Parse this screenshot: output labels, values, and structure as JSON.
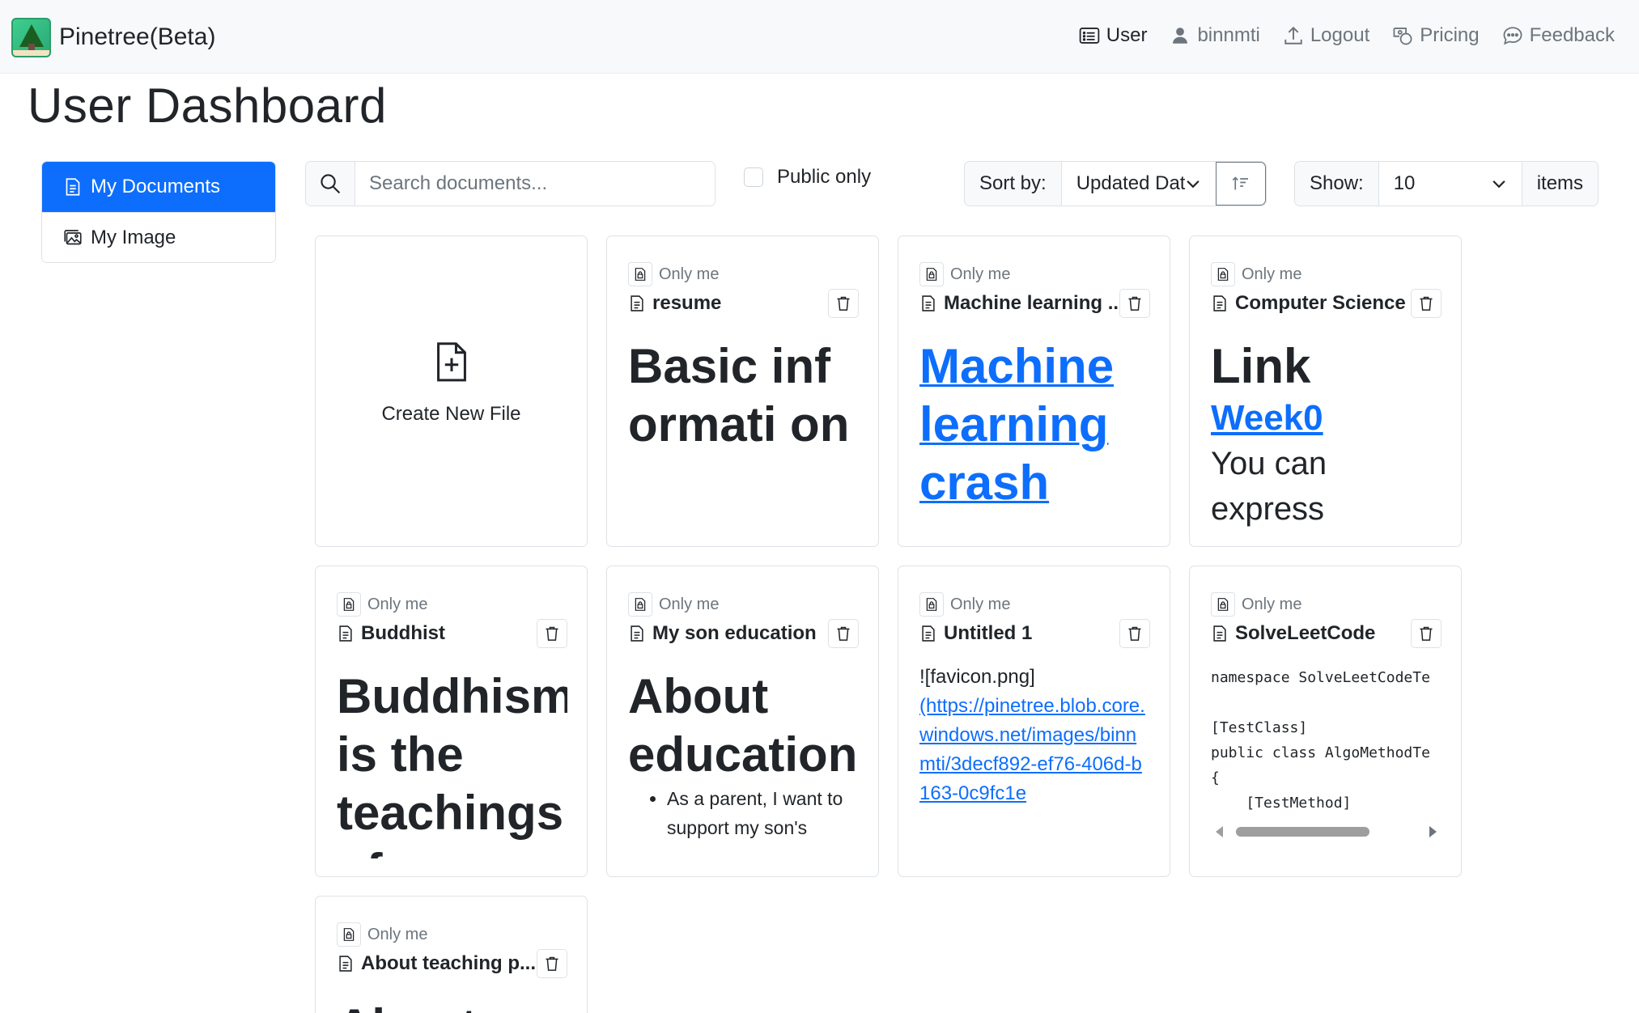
{
  "navbar": {
    "brand": "Pinetree(Beta)",
    "links": [
      {
        "label": "User",
        "icon": "card-list-icon",
        "active": true
      },
      {
        "label": "binnmti",
        "icon": "person-icon"
      },
      {
        "label": "Logout",
        "icon": "upload-icon"
      },
      {
        "label": "Pricing",
        "icon": "cash-coin-icon"
      },
      {
        "label": "Feedback",
        "icon": "chat-dots-icon"
      }
    ]
  },
  "page": {
    "title": "User Dashboard"
  },
  "sidebar": {
    "items": [
      {
        "label": "My Documents",
        "icon": "file-text-icon",
        "active": true
      },
      {
        "label": "My Image",
        "icon": "images-icon"
      }
    ]
  },
  "toolbar": {
    "search_placeholder": "Search documents...",
    "public_only_label": "Public only",
    "sort_label": "Sort by:",
    "sort_value": "Updated Date",
    "show_label": "Show:",
    "show_value": "10",
    "items_label": "items"
  },
  "create_card": {
    "label": "Create New File"
  },
  "cards": [
    {
      "visibility": "Only me",
      "title": "resume",
      "preview_heading": "Basic informati on"
    },
    {
      "visibility": "Only me",
      "title": "Machine learning ...",
      "preview_link": "Machine learning crash"
    },
    {
      "visibility": "Only me",
      "title": "Computer Science",
      "preview_heading": "Link",
      "preview_link": "Week0",
      "preview_text": "You can express"
    },
    {
      "visibility": "Only me",
      "title": "Buddhist",
      "preview_heading": "Buddhism is the teachings of Buddha"
    },
    {
      "visibility": "Only me",
      "title": "My son education",
      "preview_heading": "About education",
      "preview_bullet": "As a parent, I want to support my son's"
    },
    {
      "visibility": "Only me",
      "title": "Untitled 1",
      "preview_text": "![favicon.png]",
      "preview_link": "(https://pinetree.blob.core.windows.net/images/binnmti/3decf892-ef76-406d-b163-0c9fc1e"
    },
    {
      "visibility": "Only me",
      "title": "SolveLeetCode",
      "preview_code": "namespace SolveLeetCodeTe\n\n[TestClass]\npublic class AlgoMethodTe\n{\n    [TestMethod]"
    },
    {
      "visibility": "Only me",
      "title": "About teaching p...",
      "preview_heading": "About"
    }
  ]
}
